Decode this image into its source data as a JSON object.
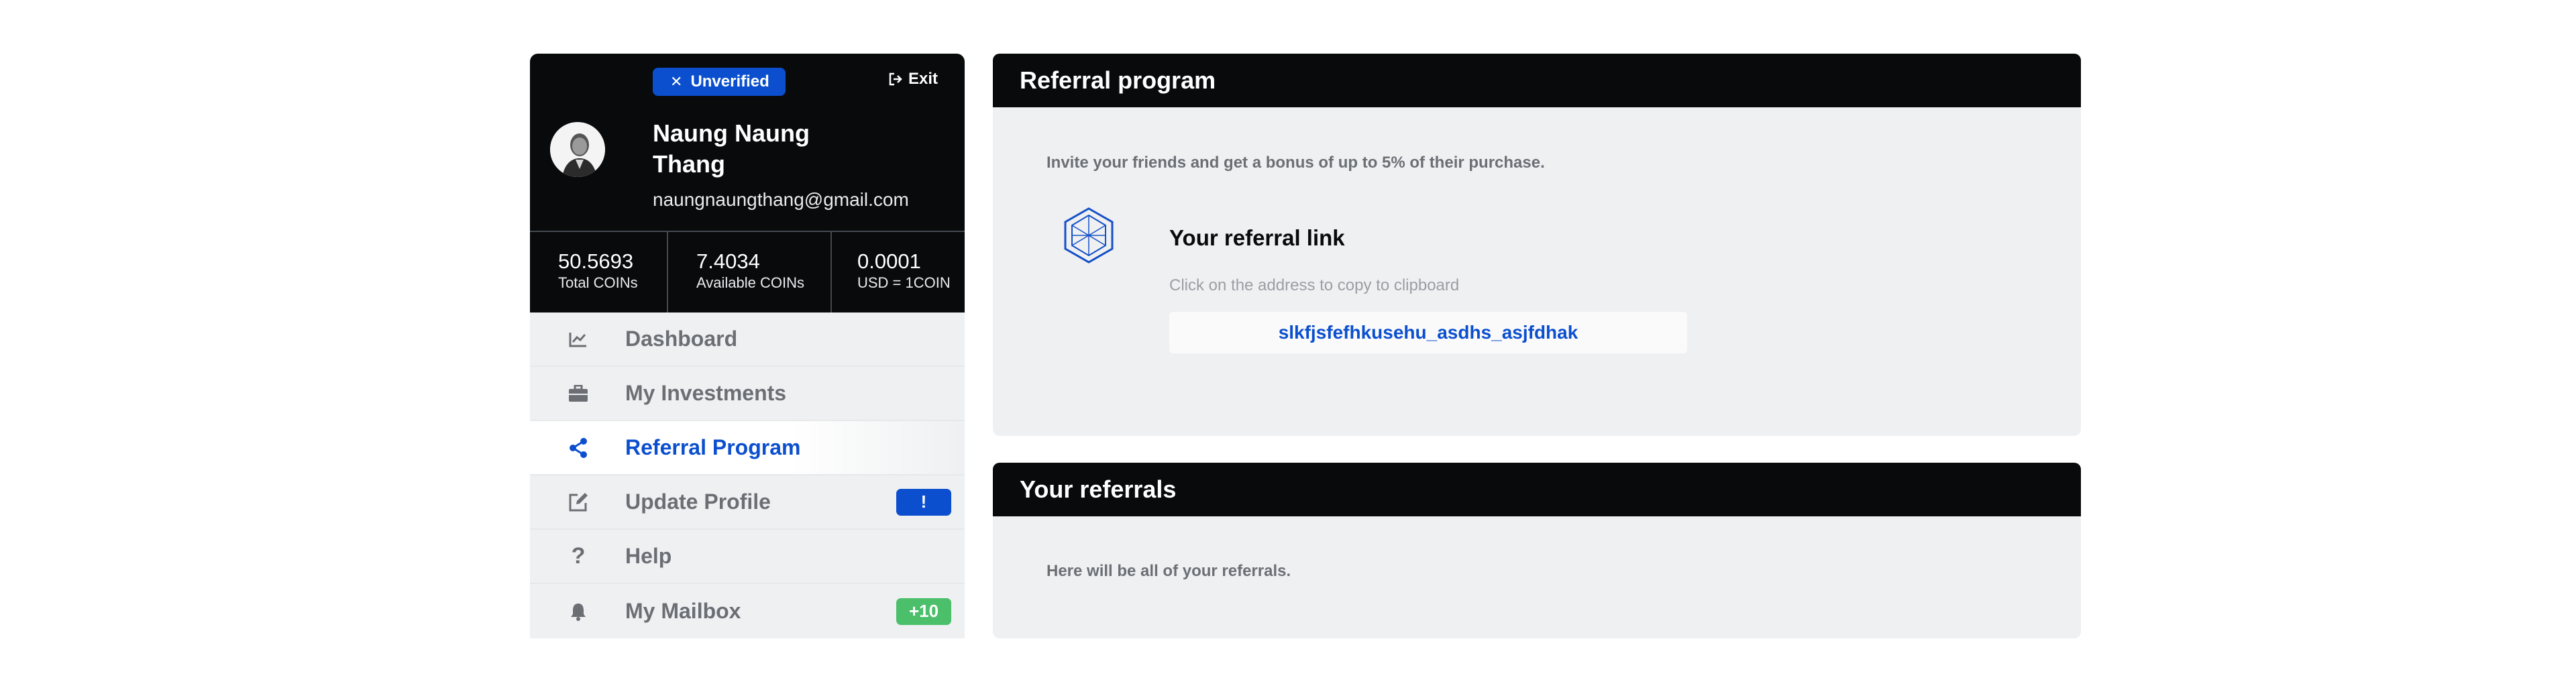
{
  "user": {
    "status_badge": "Unverified",
    "name": "Naung Naung Thang",
    "email": "naungnaungthang@gmail.com",
    "exit_label": "Exit"
  },
  "stats": [
    {
      "value": "50.5693",
      "label": "Total COINs"
    },
    {
      "value": "7.4034",
      "label": "Available COINs"
    },
    {
      "value": "0.0001",
      "label": "USD = 1COIN"
    }
  ],
  "menu": [
    {
      "label": "Dashboard",
      "icon": "chart-line-icon"
    },
    {
      "label": "My Investments",
      "icon": "briefcase-icon"
    },
    {
      "label": "Referral Program",
      "icon": "share-icon",
      "active": true
    },
    {
      "label": "Update Profile",
      "icon": "edit-icon",
      "badge": "!"
    },
    {
      "label": "Help",
      "icon": "question-icon"
    },
    {
      "label": "My Mailbox",
      "icon": "bell-icon",
      "badge": "+10"
    }
  ],
  "referral_program": {
    "title": "Referral program",
    "description": "Invite your friends and get a bonus of up to 5% of their purchase.",
    "link_title": "Your referral link",
    "link_hint": "Click on the address to copy to clipboard",
    "link_value": "slkfjsfefhkusehu_asdhs_asjfdhak"
  },
  "your_referrals": {
    "title": "Your referrals",
    "description": "Here will be all of your referrals."
  },
  "colors": {
    "accent": "#0b4fce",
    "dark": "#080a0c",
    "panel_bg": "#eff0f2",
    "success": "#4cbf6b"
  }
}
